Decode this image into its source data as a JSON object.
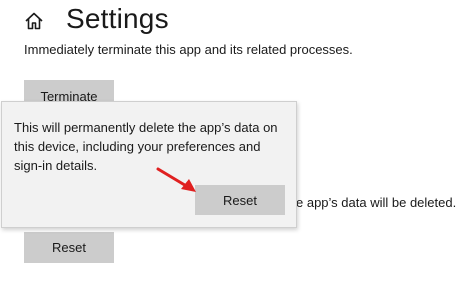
{
  "header": {
    "home_icon": "home-icon",
    "title": "Settings"
  },
  "main": {
    "terminate_description": "Immediately terminate this app and its related processes.",
    "terminate_label": "Terminate",
    "reset_partial_text": "e app’s data will be deleted.",
    "reset_label": "Reset"
  },
  "dialog": {
    "message": "This will permanently delete the app’s data on this device, including your preferences and sign-in details.",
    "confirm_label": "Reset"
  },
  "annotation": {
    "arrow_icon": "red-arrow-icon",
    "arrow_color": "#e02020"
  }
}
